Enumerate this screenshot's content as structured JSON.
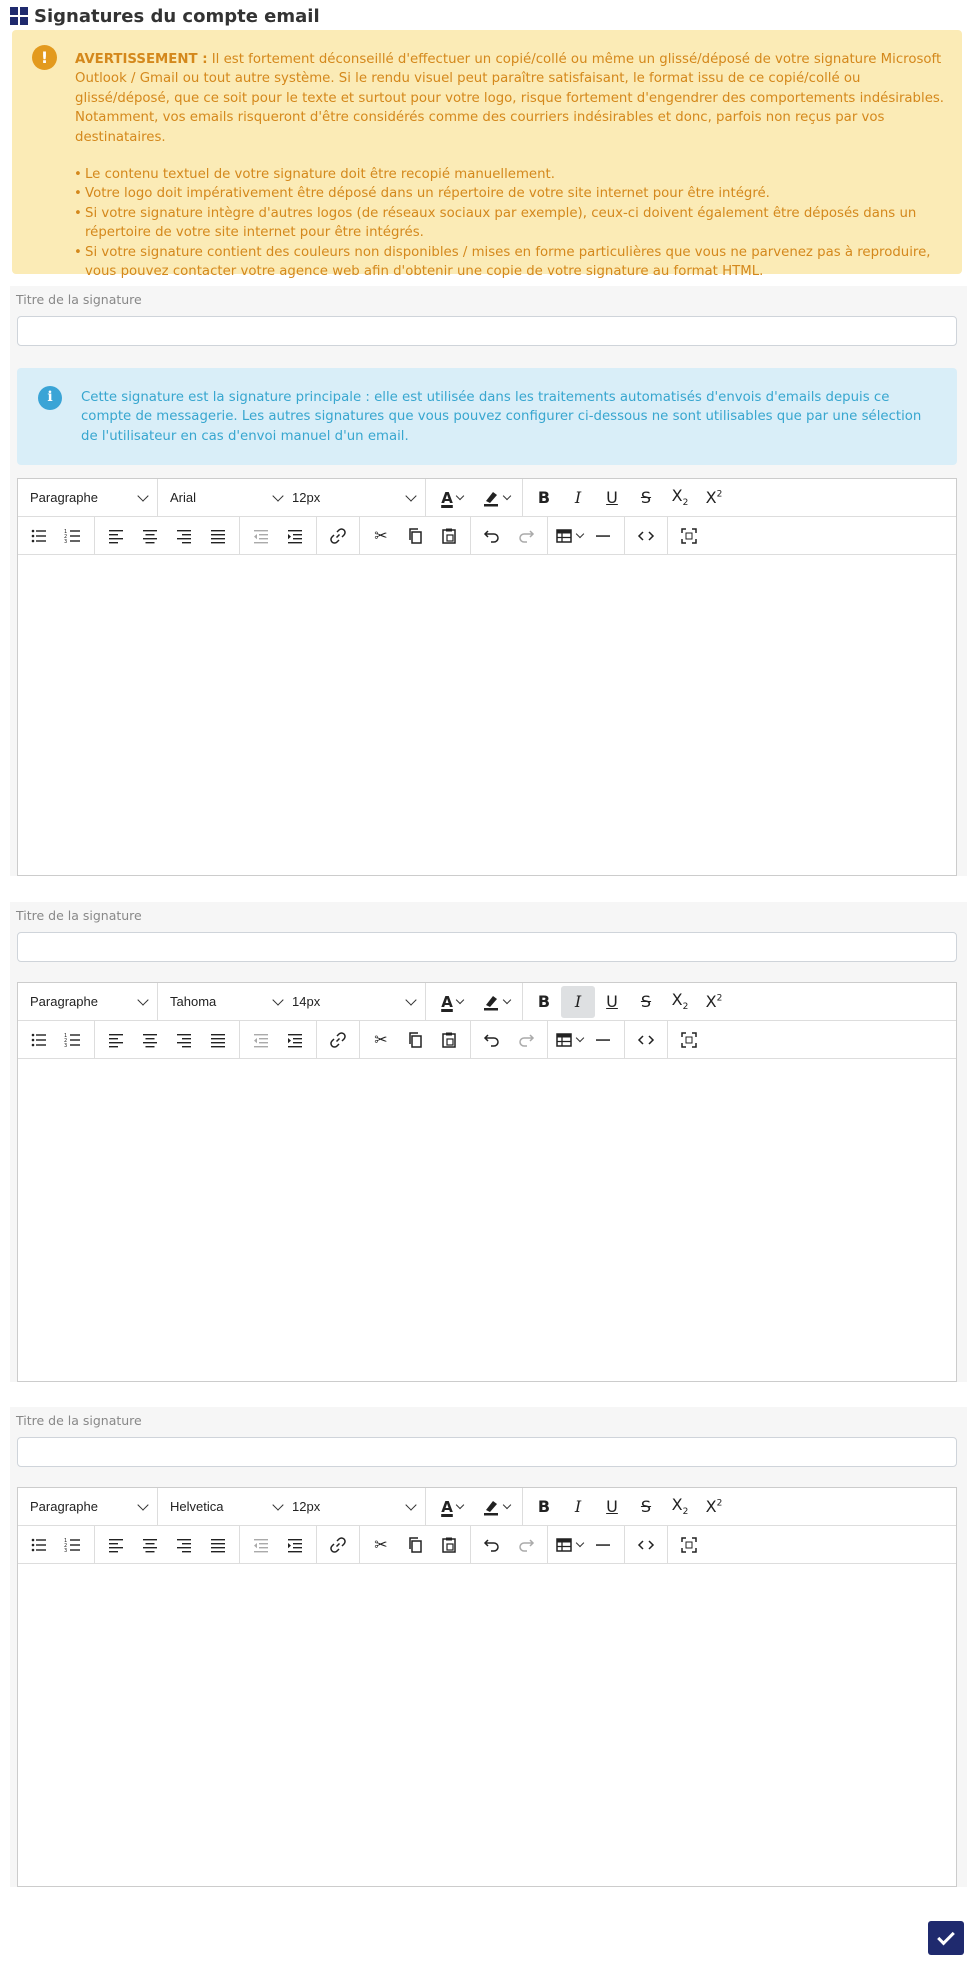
{
  "page": {
    "title": "Signatures du compte email",
    "title_icon": "grid-icon"
  },
  "warning": {
    "icon": "exclamation-icon",
    "heading": "AVERTISSEMENT :",
    "text": "Il est fortement déconseillé d'effectuer un copié/collé ou même un glissé/déposé de votre signature Microsoft Outlook / Gmail ou tout autre système. Si le rendu visuel peut paraître satisfaisant, le format issu de ce copié/collé ou glissé/déposé, que ce soit pour le texte et surtout pour votre logo, risque fortement d'engendrer des comportements indésirables. Notamment, vos emails risqueront d'être considérés comme des courriers indésirables et donc, parfois non reçus par vos destinataires.",
    "items": [
      "Le contenu textuel de votre signature doit être recopié manuellement.",
      "Votre logo doit impérativement être déposé dans un répertoire de votre site internet pour être intégré.",
      "Si votre signature intègre d'autres logos (de réseaux sociaux par exemple), ceux-ci doivent également être déposés dans un répertoire de votre site internet pour être intégrés.",
      "Si votre signature contient des couleurs non disponibles / mises en forme particulières que vous ne parvenez pas à reproduire, vous pouvez contacter votre agence web afin d'obtenir une copie de votre signature au format HTML."
    ]
  },
  "info": {
    "icon": "info-icon",
    "text": "Cette signature est la signature principale : elle est utilisée dans les traitements automatisés d'envois d'emails depuis ce compte de messagerie. Les autres signatures que vous pouvez configurer ci-dessous ne sont utilisables que par une sélection de l'utilisateur en cas d'envoi manuel d'un email."
  },
  "signatures": [
    {
      "label": "Titre de la signature",
      "value": "",
      "block": "Paragraphe",
      "font": "Arial",
      "size": "12px"
    },
    {
      "label": "Titre de la signature",
      "value": "",
      "block": "Paragraphe",
      "font": "Tahoma",
      "size": "14px"
    },
    {
      "label": "Titre de la signature",
      "value": "",
      "block": "Paragraphe",
      "font": "Helvetica",
      "size": "12px"
    }
  ],
  "colors": {
    "brand": "#1f2a6e",
    "warning_bg": "#fbebb6",
    "warning_text": "#d4881c",
    "info_bg": "#d9eef8",
    "info_text": "#37a6cf"
  },
  "actions": {
    "save_icon": "check-icon"
  }
}
